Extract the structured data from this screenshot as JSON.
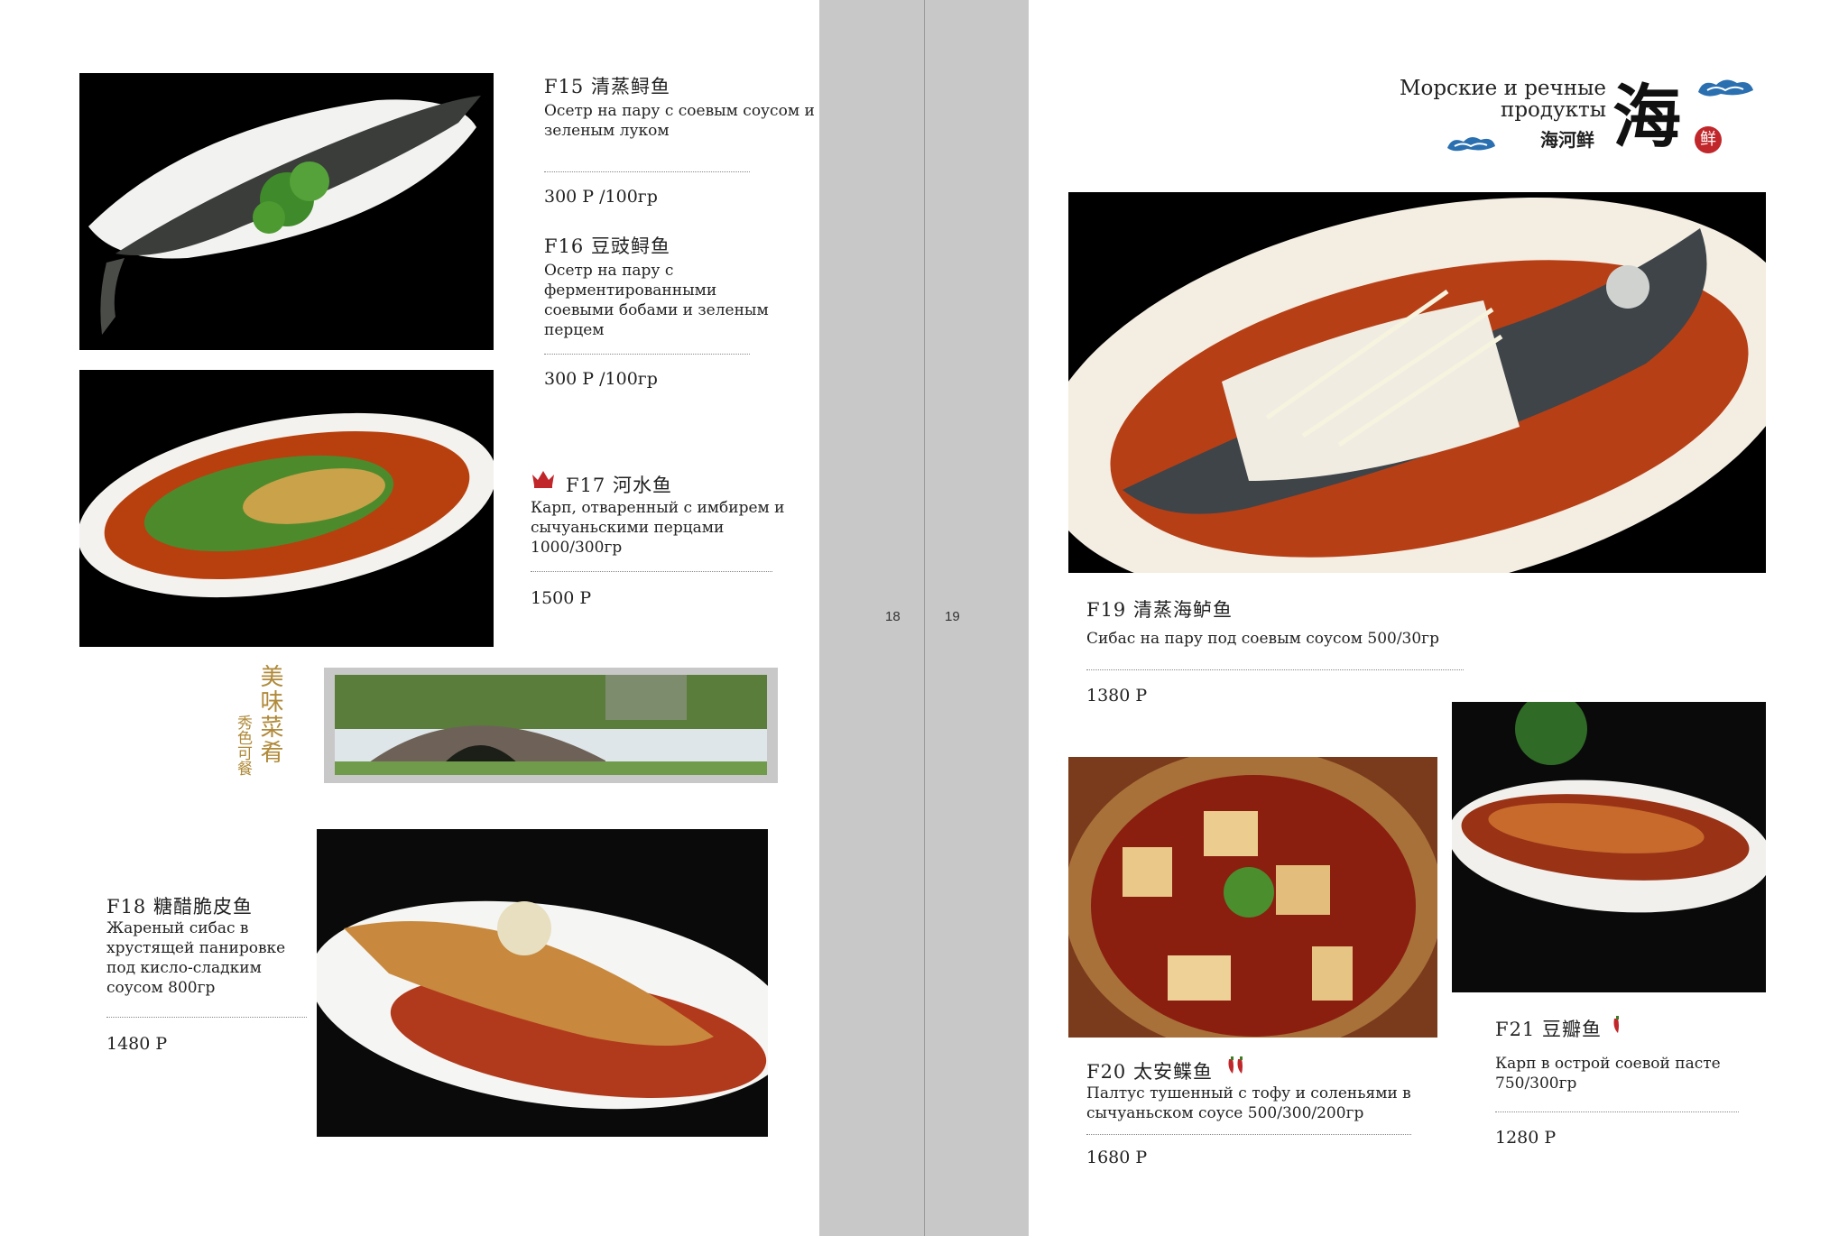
{
  "page_numbers": {
    "left": "18",
    "right": "19"
  },
  "section": {
    "title_ru_line1": "Морские и речные",
    "title_ru_line2": "продукты",
    "title_zh": "海河鲜",
    "big_char": "海",
    "seal_char": "鲜"
  },
  "decor": {
    "main_vertical": "美味菜肴",
    "sub_vertical": "秀色可餐"
  },
  "dishes": [
    {
      "code_title": "F15 清蒸鲟鱼",
      "desc": "Осетр на пару с соевым соусом и зеленым луком",
      "price": "300 Р /100гр"
    },
    {
      "code_title": "F16 豆豉鲟鱼",
      "desc": "Осетр на пару с ферментированными соевыми бобами и зеленым перцем",
      "price": "300 Р /100гр"
    },
    {
      "code_title": "F17 河水鱼",
      "desc": "Карп, отваренный с имбирем и сычуаньскими перцами 1000/300гр",
      "price": "1500 Р"
    },
    {
      "code_title": "F18 糖醋脆皮鱼",
      "desc": "Жареный сибас в хрустящей панировке под кисло-сладким соусом 800гр",
      "price": "1480 Р"
    },
    {
      "code_title": "F19 清蒸海鲈鱼",
      "desc": "Сибас на пару под соевым соусом 500/30гр",
      "price": "1380 Р"
    },
    {
      "code_title": "F20 太安鲽鱼",
      "desc": "Палтус тушенный с тофу и соленьями в сычуаньском соусе 500/300/200гр",
      "price": "1680 Р"
    },
    {
      "code_title": "F21 豆瓣鱼",
      "desc": "Карп в острой соевой пасте 750/300гр",
      "price": "1280 Р"
    }
  ],
  "icons": {
    "crown": "crown-icon",
    "chili": "chili-pepper-icon"
  },
  "colors": {
    "gutter": "#c8c8c8",
    "accent_red": "#c0262a",
    "gold": "#b08a3a"
  }
}
